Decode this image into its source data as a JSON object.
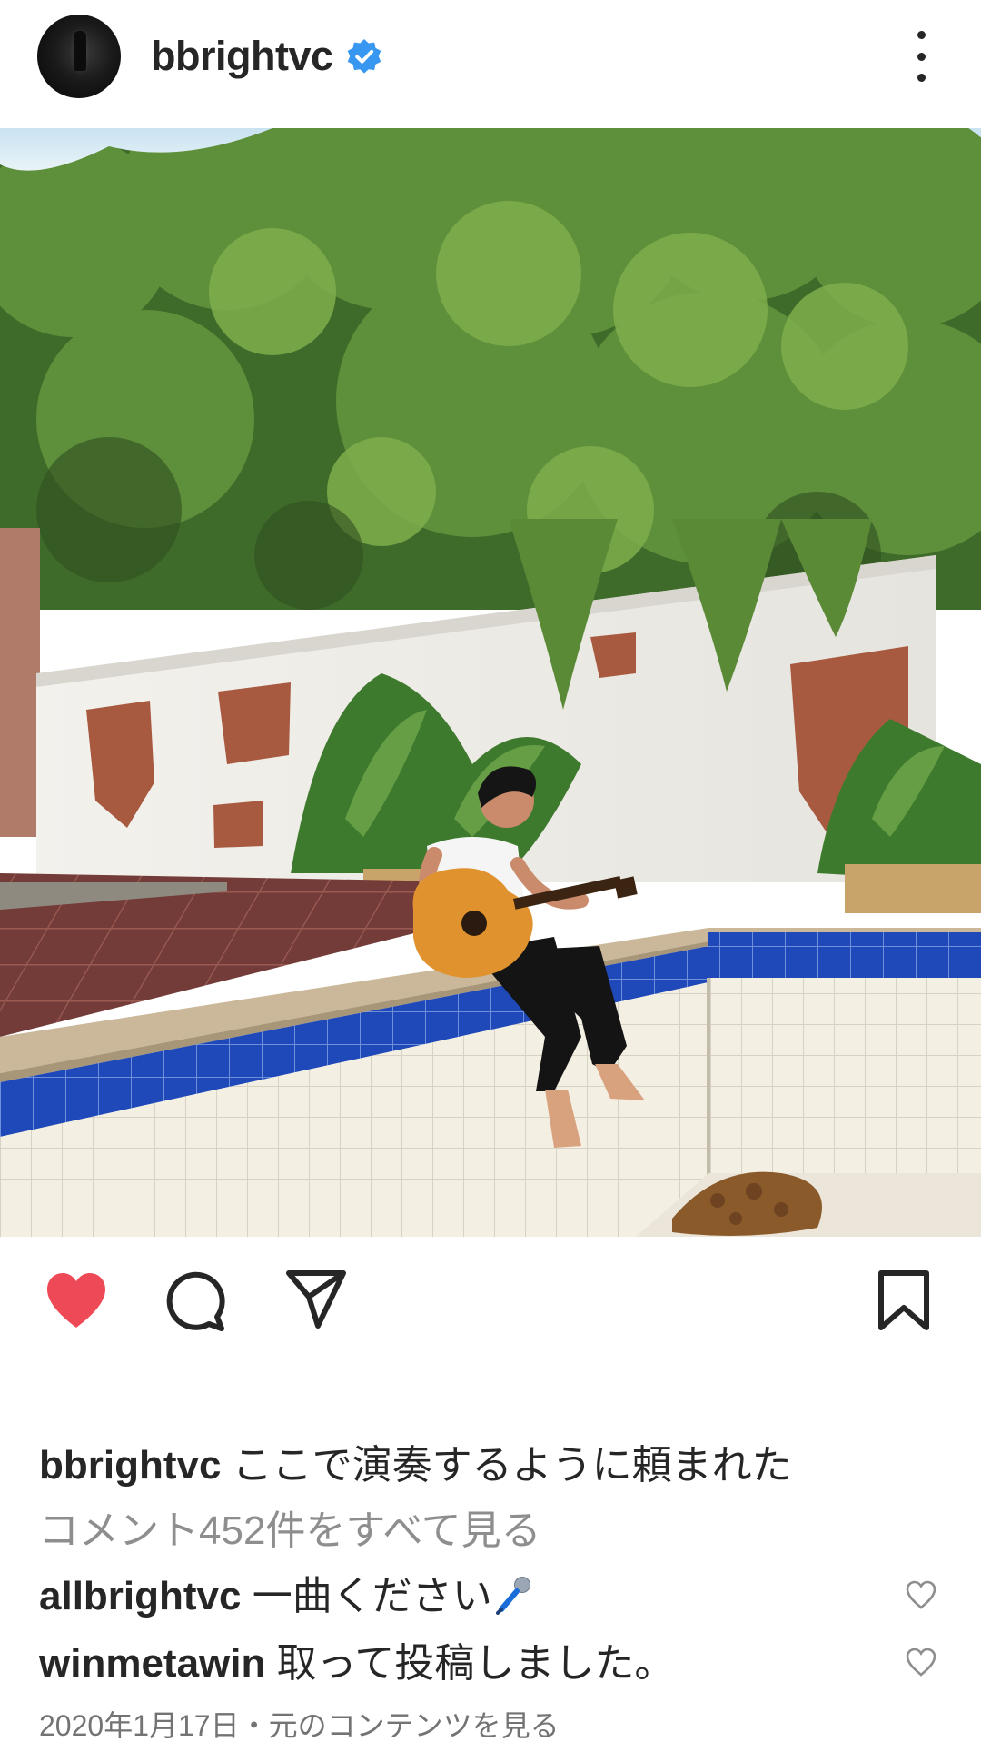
{
  "post": {
    "author": "bbrightvc",
    "verified": true,
    "caption_user": "bbrightvc",
    "caption_text": "ここで演奏するように頼まれた",
    "view_comments": "コメント452件をすべて見る",
    "date": "2020年1月17日",
    "separator": "・",
    "original_content_link": "元のコンテンツを見る",
    "liked": true
  },
  "comments": [
    {
      "user": "allbrightvc",
      "text": "一曲ください",
      "emoji_icon": "microphone-icon"
    },
    {
      "user": "winmetawin",
      "text": "取って投稿しました。"
    }
  ],
  "icons": {
    "header": [
      "avatar",
      "verified-badge-icon",
      "more-options-icon"
    ],
    "actions": [
      "heart-icon",
      "comment-icon",
      "share-icon",
      "bookmark-icon"
    ]
  },
  "colors": {
    "like_red": "#ed4956",
    "verified_blue": "#3897f0",
    "text_primary": "#262626",
    "text_secondary": "#8e8e8e"
  }
}
